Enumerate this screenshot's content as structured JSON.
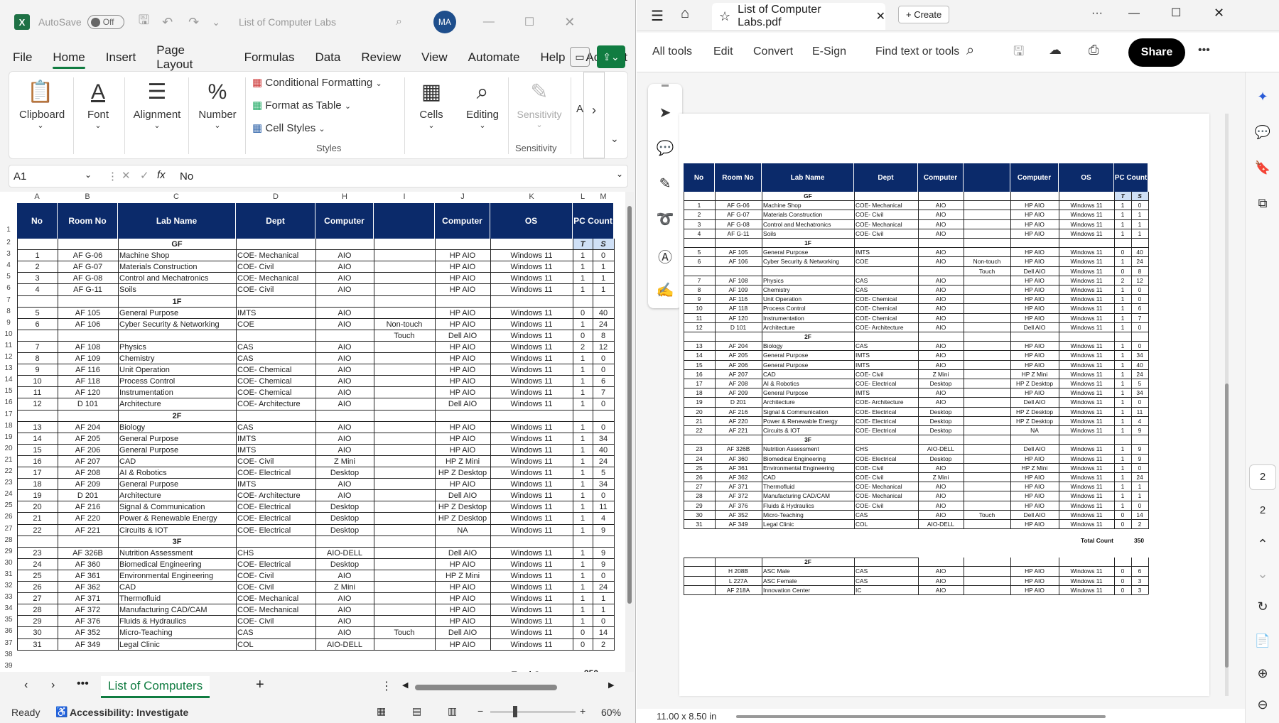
{
  "excel": {
    "title": "List of Computer Labs",
    "autosave_label": "AutoSave",
    "autosave_state": "Off",
    "avatar": "MA",
    "menu": [
      "File",
      "Home",
      "Insert",
      "Page Layout",
      "Formulas",
      "Data",
      "Review",
      "View",
      "Automate",
      "Help",
      "Acrobat"
    ],
    "ribbon": {
      "clipboard": "Clipboard",
      "font": "Font",
      "alignment": "Alignment",
      "number": "Number",
      "conditional_formatting": "Conditional Formatting",
      "format_as_table": "Format as Table",
      "cell_styles": "Cell Styles",
      "styles": "Styles",
      "cells": "Cells",
      "editing": "Editing",
      "sensitivity": "Sensitivity",
      "sensitivity_group": "Sensitivity",
      "more": "A"
    },
    "name_box": "A1",
    "formula": "No",
    "columns": [
      "A",
      "B",
      "C",
      "D",
      "H",
      "I",
      "J",
      "K",
      "L",
      "M"
    ],
    "headers": [
      "No",
      "Room No",
      "Lab Name",
      "Dept",
      "Computer",
      "",
      "Computer",
      "OS",
      "PC Count"
    ],
    "tl": [
      "T",
      "S"
    ],
    "rows": [
      [
        "1",
        "AF G-06",
        "Machine Shop",
        "COE- Mechanical",
        "AIO",
        "",
        "HP AIO",
        "Windows 11",
        "1",
        "0"
      ],
      [
        "2",
        "AF G-07",
        "Materials Construction",
        "COE- Civil",
        "AIO",
        "",
        "HP AIO",
        "Windows 11",
        "1",
        "1"
      ],
      [
        "3",
        "AF G-08",
        "Control and Mechatronics",
        "COE- Mechanical",
        "AIO",
        "",
        "HP AIO",
        "Windows 11",
        "1",
        "1"
      ],
      [
        "4",
        "AF G-11",
        "Soils",
        "COE- Civil",
        "AIO",
        "",
        "HP AIO",
        "Windows 11",
        "1",
        "1"
      ],
      [
        "5",
        "AF 105",
        "General Purpose",
        "IMTS",
        "AIO",
        "",
        "HP AIO",
        "Windows 11",
        "0",
        "40"
      ],
      [
        "6",
        "AF 106",
        "Cyber Security & Networking",
        "COE",
        "AIO",
        "Non-touch",
        "HP AIO",
        "Windows 11",
        "1",
        "24"
      ],
      [
        "",
        "",
        "",
        "",
        "",
        "Touch",
        "Dell AIO",
        "Windows 11",
        "0",
        "8"
      ],
      [
        "7",
        "AF 108",
        "Physics",
        "CAS",
        "AIO",
        "",
        "HP AIO",
        "Windows 11",
        "2",
        "12"
      ],
      [
        "8",
        "AF 109",
        "Chemistry",
        "CAS",
        "AIO",
        "",
        "HP AIO",
        "Windows 11",
        "1",
        "0"
      ],
      [
        "9",
        "AF 116",
        "Unit Operation",
        "COE- Chemical",
        "AIO",
        "",
        "HP AIO",
        "Windows 11",
        "1",
        "0"
      ],
      [
        "10",
        "AF 118",
        "Process Control",
        "COE- Chemical",
        "AIO",
        "",
        "HP AIO",
        "Windows 11",
        "1",
        "6"
      ],
      [
        "11",
        "AF 120",
        "Instrumentation",
        "COE- Chemical",
        "AIO",
        "",
        "HP AIO",
        "Windows 11",
        "1",
        "7"
      ],
      [
        "12",
        "D 101",
        "Architecture",
        "COE- Architecture",
        "AIO",
        "",
        "Dell AIO",
        "Windows 11",
        "1",
        "0"
      ],
      [
        "13",
        "AF 204",
        "Biology",
        "CAS",
        "AIO",
        "",
        "HP AIO",
        "Windows 11",
        "1",
        "0"
      ],
      [
        "14",
        "AF 205",
        "General Purpose",
        "IMTS",
        "AIO",
        "",
        "HP AIO",
        "Windows 11",
        "1",
        "34"
      ],
      [
        "15",
        "AF 206",
        "General Purpose",
        "IMTS",
        "AIO",
        "",
        "HP AIO",
        "Windows 11",
        "1",
        "40"
      ],
      [
        "16",
        "AF 207",
        "CAD",
        "COE- Civil",
        "Z Mini",
        "",
        "HP Z Mini",
        "Windows 11",
        "1",
        "24"
      ],
      [
        "17",
        "AF 208",
        "AI & Robotics",
        "COE- Electrical",
        "Desktop",
        "",
        "HP Z Desktop",
        "Windows 11",
        "1",
        "5"
      ],
      [
        "18",
        "AF 209",
        "General Purpose",
        "IMTS",
        "AIO",
        "",
        "HP AIO",
        "Windows 11",
        "1",
        "34"
      ],
      [
        "19",
        "D 201",
        "Architecture",
        "COE- Architecture",
        "AIO",
        "",
        "Dell AIO",
        "Windows 11",
        "1",
        "0"
      ],
      [
        "20",
        "AF 216",
        "Signal & Communication",
        "COE- Electrical",
        "Desktop",
        "",
        "HP Z Desktop",
        "Windows 11",
        "1",
        "11"
      ],
      [
        "21",
        "AF 220",
        "Power & Renewable Energy",
        "COE- Electrical",
        "Desktop",
        "",
        "HP Z Desktop",
        "Windows 11",
        "1",
        "4"
      ],
      [
        "22",
        "AF 221",
        "Circuits & IOT",
        "COE- Electrical",
        "Desktop",
        "",
        "NA",
        "Windows 11",
        "1",
        "9"
      ],
      [
        "23",
        "AF 326B",
        "Nutrition Assessment",
        "CHS",
        "AIO-DELL",
        "",
        "Dell AIO",
        "Windows 11",
        "1",
        "9"
      ],
      [
        "24",
        "AF 360",
        "Biomedical Engineering",
        "COE- Electrical",
        "Desktop",
        "",
        "HP AIO",
        "Windows 11",
        "1",
        "9"
      ],
      [
        "25",
        "AF 361",
        "Environmental Engineering",
        "COE- Civil",
        "AIO",
        "",
        "HP Z Mini",
        "Windows 11",
        "1",
        "0"
      ],
      [
        "26",
        "AF 362",
        "CAD",
        "COE- Civil",
        "Z Mini",
        "",
        "HP AIO",
        "Windows 11",
        "1",
        "24"
      ],
      [
        "27",
        "AF 371",
        "Thermofluid",
        "COE- Mechanical",
        "AIO",
        "",
        "HP AIO",
        "Windows 11",
        "1",
        "1"
      ],
      [
        "28",
        "AF 372",
        "Manufacturing CAD/CAM",
        "COE- Mechanical",
        "AIO",
        "",
        "HP AIO",
        "Windows 11",
        "1",
        "1"
      ],
      [
        "29",
        "AF 376",
        "Fluids & Hydraulics",
        "COE- Civil",
        "AIO",
        "",
        "HP AIO",
        "Windows 11",
        "1",
        "0"
      ],
      [
        "30",
        "AF 352",
        "Micro-Teaching",
        "CAS",
        "AIO",
        "Touch",
        "Dell AIO",
        "Windows 11",
        "0",
        "14"
      ],
      [
        "31",
        "AF 349",
        "Legal Clinic",
        "COL",
        "AIO-DELL",
        "",
        "HP AIO",
        "Windows 11",
        "0",
        "2"
      ]
    ],
    "floors": [
      "GF",
      "1F",
      "2F",
      "3F"
    ],
    "total_label": "Total Count",
    "total_value": "350",
    "sheet_tab": "List of Computers",
    "status_ready": "Ready",
    "status_accessibility": "Accessibility: Investigate",
    "zoom": "60%"
  },
  "pdf": {
    "tab_title": "List of Computer Labs.pdf",
    "create_label": "Create",
    "tools": [
      "All tools",
      "Edit",
      "Convert",
      "E-Sign"
    ],
    "find_label": "Find text or tools",
    "share_label": "Share",
    "page_current": "2",
    "page_total": "2",
    "page_size": "11.00 x 8.50 in",
    "extra_floor": "2F",
    "extra_rows": [
      [
        "",
        "H 208B",
        "ASC Male",
        "CAS",
        "AIO",
        "",
        "HP AIO",
        "Windows 11",
        "0",
        "6"
      ],
      [
        "",
        "L 227A",
        "ASC Female",
        "CAS",
        "AIO",
        "",
        "HP AIO",
        "Windows 11",
        "0",
        "3"
      ],
      [
        "",
        "AF 218A",
        "Innovation Center",
        "IC",
        "AIO",
        "",
        "HP AIO",
        "Windows 11",
        "0",
        "3"
      ]
    ]
  }
}
